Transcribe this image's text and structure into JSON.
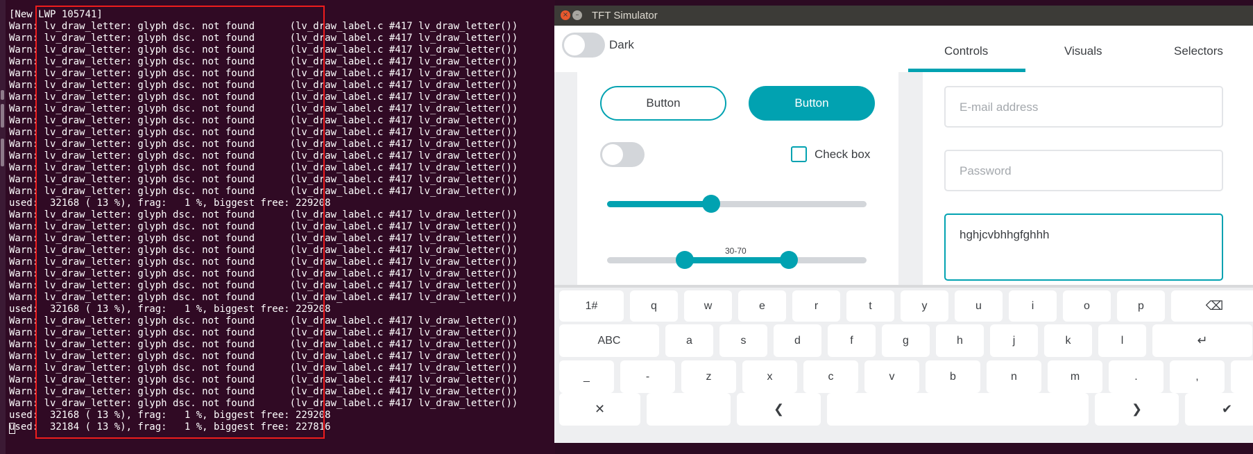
{
  "terminal": {
    "lines": [
      "[New LWP 105741]",
      "Warn: lv_draw_letter: glyph dsc. not found      (lv_draw_label.c #417 lv_draw_letter())",
      "Warn: lv_draw_letter: glyph dsc. not found      (lv_draw_label.c #417 lv_draw_letter())",
      "Warn: lv_draw_letter: glyph dsc. not found      (lv_draw_label.c #417 lv_draw_letter())",
      "Warn: lv_draw_letter: glyph dsc. not found      (lv_draw_label.c #417 lv_draw_letter())",
      "Warn: lv_draw_letter: glyph dsc. not found      (lv_draw_label.c #417 lv_draw_letter())",
      "Warn: lv_draw_letter: glyph dsc. not found      (lv_draw_label.c #417 lv_draw_letter())",
      "Warn: lv_draw_letter: glyph dsc. not found      (lv_draw_label.c #417 lv_draw_letter())",
      "Warn: lv_draw_letter: glyph dsc. not found      (lv_draw_label.c #417 lv_draw_letter())",
      "Warn: lv_draw_letter: glyph dsc. not found      (lv_draw_label.c #417 lv_draw_letter())",
      "Warn: lv_draw_letter: glyph dsc. not found      (lv_draw_label.c #417 lv_draw_letter())",
      "Warn: lv_draw_letter: glyph dsc. not found      (lv_draw_label.c #417 lv_draw_letter())",
      "Warn: lv_draw_letter: glyph dsc. not found      (lv_draw_label.c #417 lv_draw_letter())",
      "Warn: lv_draw_letter: glyph dsc. not found      (lv_draw_label.c #417 lv_draw_letter())",
      "Warn: lv_draw_letter: glyph dsc. not found      (lv_draw_label.c #417 lv_draw_letter())",
      "Warn: lv_draw_letter: glyph dsc. not found      (lv_draw_label.c #417 lv_draw_letter())",
      "used:  32168 ( 13 %), frag:   1 %, biggest free: 229208",
      "Warn: lv_draw_letter: glyph dsc. not found      (lv_draw_label.c #417 lv_draw_letter())",
      "Warn: lv_draw_letter: glyph dsc. not found      (lv_draw_label.c #417 lv_draw_letter())",
      "Warn: lv_draw_letter: glyph dsc. not found      (lv_draw_label.c #417 lv_draw_letter())",
      "Warn: lv_draw_letter: glyph dsc. not found      (lv_draw_label.c #417 lv_draw_letter())",
      "Warn: lv_draw_letter: glyph dsc. not found      (lv_draw_label.c #417 lv_draw_letter())",
      "Warn: lv_draw_letter: glyph dsc. not found      (lv_draw_label.c #417 lv_draw_letter())",
      "Warn: lv_draw_letter: glyph dsc. not found      (lv_draw_label.c #417 lv_draw_letter())",
      "Warn: lv_draw_letter: glyph dsc. not found      (lv_draw_label.c #417 lv_draw_letter())",
      "used:  32168 ( 13 %), frag:   1 %, biggest free: 229208",
      "Warn: lv_draw_letter: glyph dsc. not found      (lv_draw_label.c #417 lv_draw_letter())",
      "Warn: lv_draw_letter: glyph dsc. not found      (lv_draw_label.c #417 lv_draw_letter())",
      "Warn: lv_draw_letter: glyph dsc. not found      (lv_draw_label.c #417 lv_draw_letter())",
      "Warn: lv_draw_letter: glyph dsc. not found      (lv_draw_label.c #417 lv_draw_letter())",
      "Warn: lv_draw_letter: glyph dsc. not found      (lv_draw_label.c #417 lv_draw_letter())",
      "Warn: lv_draw_letter: glyph dsc. not found      (lv_draw_label.c #417 lv_draw_letter())",
      "Warn: lv_draw_letter: glyph dsc. not found      (lv_draw_label.c #417 lv_draw_letter())",
      "Warn: lv_draw_letter: glyph dsc. not found      (lv_draw_label.c #417 lv_draw_letter())",
      "used:  32168 ( 13 %), frag:   1 %, biggest free: 229208",
      "used:  32184 ( 13 %), frag:   1 %, biggest free: 227816"
    ],
    "highlight_color": "#ef1d1d"
  },
  "window": {
    "title": "TFT Simulator",
    "close_glyph": "×",
    "minimize_glyph": "–"
  },
  "app": {
    "dark_label": "Dark",
    "tabs": [
      "Controls",
      "Visuals",
      "Selectors"
    ],
    "active_tab": "Controls",
    "accent_color": "#01a2b1",
    "controls": {
      "button_outline": "Button",
      "button_filled": "Button",
      "checkbox_label": "Check box",
      "slider_value": 0.4,
      "range_label": "30-70",
      "range_min": 0.3,
      "range_max": 0.7
    },
    "form": {
      "email_placeholder": "E-mail address",
      "password_placeholder": "Password",
      "text_value": "hghjcvbhhgfghhh"
    }
  },
  "keyboard": {
    "rows": [
      [
        "1#",
        "q",
        "w",
        "e",
        "r",
        "t",
        "y",
        "u",
        "i",
        "o",
        "p",
        "backspace-icon"
      ],
      [
        "ABC",
        "a",
        "s",
        "d",
        "f",
        "g",
        "h",
        "j",
        "k",
        "l",
        "enter-icon"
      ],
      [
        "_",
        "-",
        "z",
        "x",
        "c",
        "v",
        "b",
        "n",
        "m",
        ".",
        ",",
        ":"
      ],
      [
        "close-icon",
        "",
        "arrow-left-icon",
        "",
        "arrow-right-icon",
        "check-icon"
      ]
    ],
    "icon_glyphs": {
      "backspace-icon": "⌫",
      "enter-icon": "↵",
      "close-icon": "✕",
      "arrow-left-icon": "❮",
      "arrow-right-icon": "❯",
      "check-icon": "✔"
    }
  }
}
